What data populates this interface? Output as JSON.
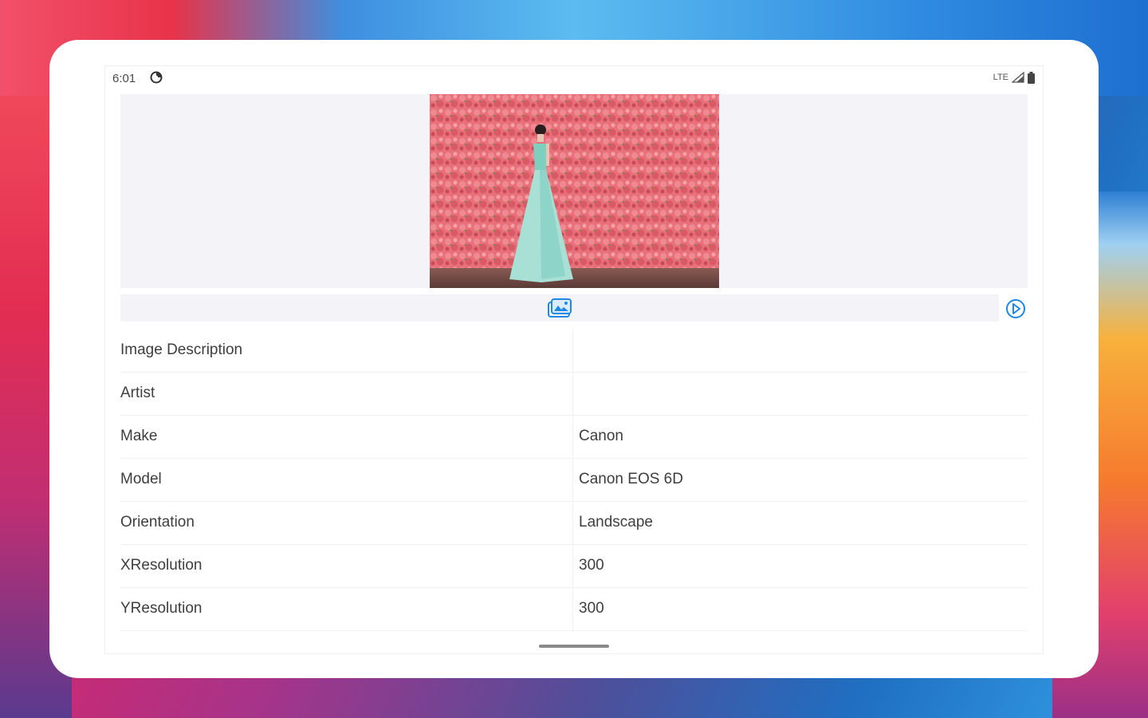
{
  "status_bar": {
    "time": "6:01",
    "network": "LTE"
  },
  "actions": {
    "edit_icon": "image-edit-icon",
    "next_icon": "play-circle-icon"
  },
  "exif": {
    "rows": [
      {
        "key": "Image Description",
        "value": ""
      },
      {
        "key": "Artist",
        "value": ""
      },
      {
        "key": "Make",
        "value": "Canon"
      },
      {
        "key": "Model",
        "value": "Canon EOS 6D"
      },
      {
        "key": "Orientation",
        "value": "Landscape"
      },
      {
        "key": "XResolution",
        "value": "300"
      },
      {
        "key": "YResolution",
        "value": "300"
      }
    ]
  },
  "colors": {
    "accent": "#1e88e5",
    "panel": "#f4f4f8"
  }
}
